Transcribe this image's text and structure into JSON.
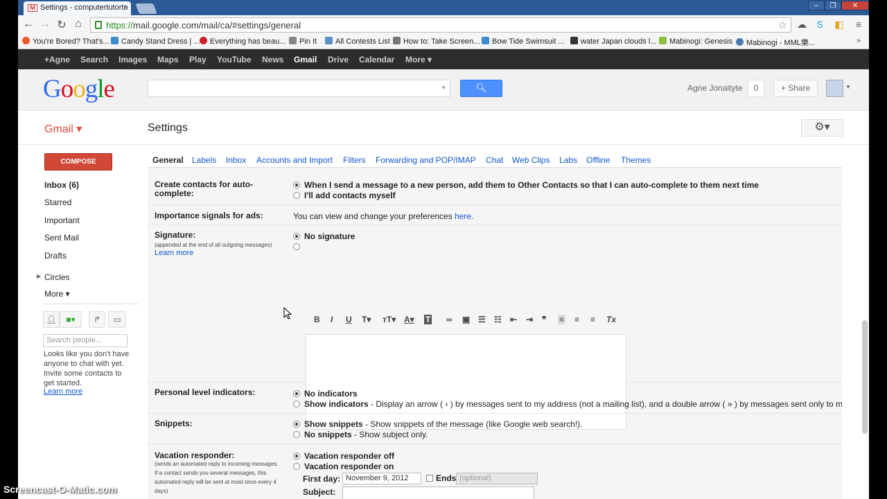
{
  "browser": {
    "tab_title": "Settings - computertutorto",
    "url_https": "https://",
    "url_rest": "mail.google.com/mail/ca/#settings/general",
    "bookmarks": [
      "You're Bored? That's...",
      "Candy Stand Dress | ...",
      "Everything has beau...",
      "Pin It",
      "All Contests List",
      "How to: Take Screen...",
      "Bow Tide Swimsuit ...",
      "water Japan clouds l...",
      "Mabinogi: Genesis",
      "Mabinogi - MML樂..."
    ]
  },
  "gbar": {
    "items": [
      "+Agne",
      "Search",
      "Images",
      "Maps",
      "Play",
      "YouTube",
      "News",
      "Gmail",
      "Drive",
      "Calendar",
      "More ▾"
    ]
  },
  "header": {
    "logo": "Google",
    "user_name": "Agne Jonaityte",
    "notification_count": "0",
    "share_label": "+ Share"
  },
  "gmail": {
    "brand": "Gmail ▾",
    "page_title": "Settings"
  },
  "sidebar": {
    "compose": "COMPOSE",
    "items": [
      "Inbox (6)",
      "Starred",
      "Important",
      "Sent Mail",
      "Drafts",
      "Circles",
      "More ▾"
    ],
    "search_placeholder": "Search people...",
    "chat_message": "Looks like you don't have anyone to chat with yet. Invite some contacts to get started.",
    "learn_more": "Learn more"
  },
  "tabs": [
    "General",
    "Labels",
    "Inbox",
    "Accounts and Import",
    "Filters",
    "Forwarding and POP/IMAP",
    "Chat",
    "Web Clips",
    "Labs",
    "Offline",
    "Themes"
  ],
  "settings": {
    "create_contacts": {
      "label": "Create contacts for auto-complete:",
      "opt1": "When I send a message to a new person, add them to Other Contacts so that I can auto-complete to them next time",
      "opt2": "I'll add contacts myself"
    },
    "importance": {
      "label": "Importance signals for ads:",
      "text": "You can view and change your preferences",
      "link": "here."
    },
    "signature": {
      "label": "Signature:",
      "sub": "(appended at the end of all outgoing messages)",
      "learn_more": "Learn more",
      "opt1": "No signature"
    },
    "personal_level": {
      "label": "Personal level indicators:",
      "opt1": "No indicators",
      "opt2": "Show indicators",
      "opt2_desc": " - Display an arrow ( › ) by messages sent to my address (not a mailing list), and a double arrow ( » ) by messages sent only to me."
    },
    "snippets": {
      "label": "Snippets:",
      "opt1": "Show snippets",
      "opt1_desc": " - Show snippets of the message (like Google web search!).",
      "opt2": "No snippets",
      "opt2_desc": " - Show subject only."
    },
    "vacation": {
      "label": "Vacation responder:",
      "sub": "(sends an automated reply to incoming messages. If a contact sends you several messages, this automated reply will be sent at most once every 4 days)",
      "opt1": "Vacation responder off",
      "opt2": "Vacation responder on",
      "first_day_label": "First day:",
      "first_day_value": "November 9, 2012",
      "ends_label": "Ends:",
      "ends_placeholder": "(optional)",
      "subject_label": "Subject:"
    }
  },
  "watermark": "Screencast-O-Matic.com"
}
